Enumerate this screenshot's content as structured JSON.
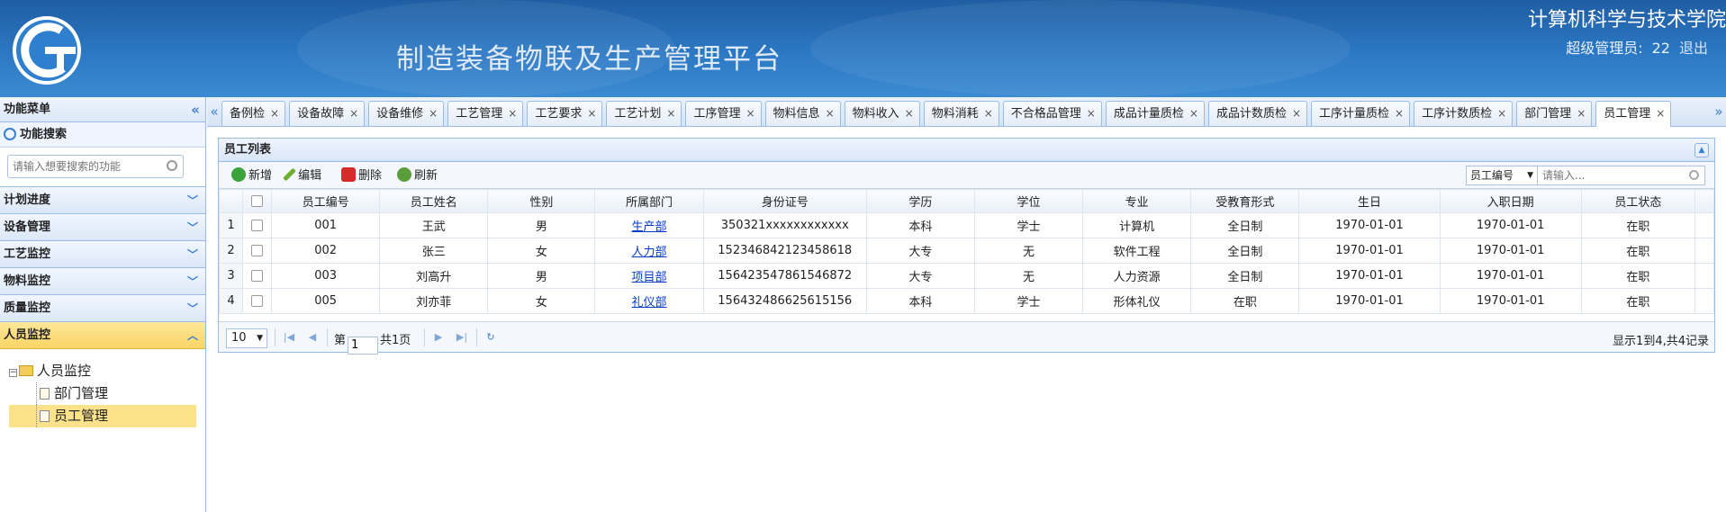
{
  "header": {
    "platform_title": "制造装备物联及生产管理平台",
    "school_name": "计算机科学与技术学院",
    "user_role": "超级管理员:",
    "user_id": "22",
    "logout": "退出"
  },
  "sidebar": {
    "menu_title": "功能菜单",
    "search_title": "功能搜索",
    "search_placeholder": "请输入想要搜索的功能",
    "sections": [
      "计划进度",
      "设备管理",
      "工艺监控",
      "物料监控",
      "质量监控",
      "人员监控"
    ],
    "active_section": "人员监控",
    "tree": {
      "root": "人员监控",
      "children": [
        "部门管理",
        "员工管理"
      ],
      "selected": "员工管理"
    }
  },
  "tabs": [
    "备例检",
    "设备故障",
    "设备维修",
    "工艺管理",
    "工艺要求",
    "工艺计划",
    "工序管理",
    "物料信息",
    "物料收入",
    "物料消耗",
    "不合格品管理",
    "成品计量质检",
    "成品计数质检",
    "工序计量质检",
    "工序计数质检",
    "部门管理",
    "员工管理"
  ],
  "active_tab": "员工管理",
  "panel": {
    "title": "员工列表",
    "toolbar": {
      "add": "新增",
      "edit": "编辑",
      "delete": "删除",
      "refresh": "刷新",
      "search_field": "员工编号",
      "search_placeholder": "请输入..."
    },
    "columns": [
      "员工编号",
      "员工姓名",
      "性别",
      "所属部门",
      "身份证号",
      "学历",
      "学位",
      "专业",
      "受教育形式",
      "生日",
      "入职日期",
      "员工状态"
    ],
    "rows": [
      {
        "n": "1",
        "id": "001",
        "name": "王武",
        "gender": "男",
        "dept": "生产部",
        "idcard": "350321xxxxxxxxxxxx",
        "edu": "本科",
        "degree": "学士",
        "major": "计算机",
        "form": "全日制",
        "birth": "1970-01-01",
        "join": "1970-01-01",
        "status": "在职"
      },
      {
        "n": "2",
        "id": "002",
        "name": "张三",
        "gender": "女",
        "dept": "人力部",
        "idcard": "152346842123458618",
        "edu": "大专",
        "degree": "无",
        "major": "软件工程",
        "form": "全日制",
        "birth": "1970-01-01",
        "join": "1970-01-01",
        "status": "在职"
      },
      {
        "n": "3",
        "id": "003",
        "name": "刘高升",
        "gender": "男",
        "dept": "项目部",
        "idcard": "156423547861546872",
        "edu": "大专",
        "degree": "无",
        "major": "人力资源",
        "form": "全日制",
        "birth": "1970-01-01",
        "join": "1970-01-01",
        "status": "在职"
      },
      {
        "n": "4",
        "id": "005",
        "name": "刘亦菲",
        "gender": "女",
        "dept": "礼仪部",
        "idcard": "156432486625615156",
        "edu": "本科",
        "degree": "学士",
        "major": "形体礼仪",
        "form": "在职",
        "birth": "1970-01-01",
        "join": "1970-01-01",
        "status": "在职"
      }
    ],
    "pager": {
      "page_size": "10",
      "page_prefix": "第",
      "page_value": "1",
      "page_suffix": "共1页",
      "info": "显示1到4,共4记录"
    }
  },
  "colors": {
    "header_blue": "#2c78c4",
    "border_blue": "#99bbe8",
    "active_yellow": "#fbd565",
    "link_blue": "#0a3cc7"
  }
}
